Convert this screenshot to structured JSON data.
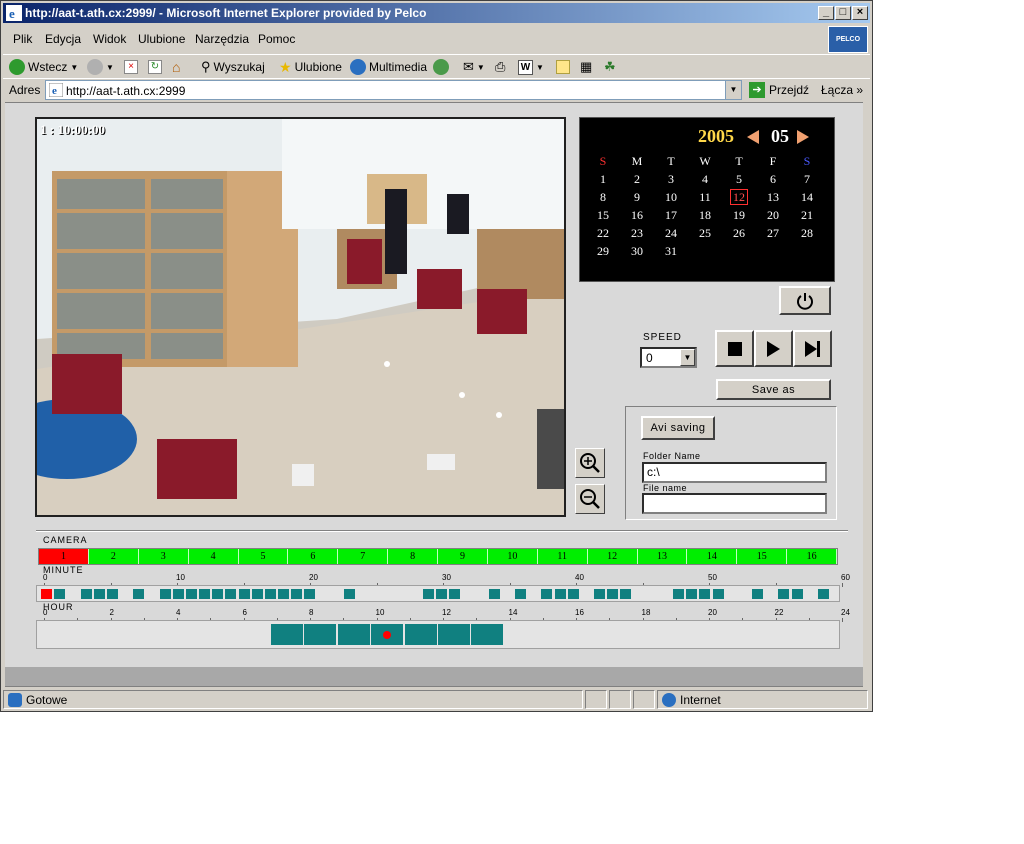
{
  "window": {
    "title": "http://aat-t.ath.cx:2999/ - Microsoft Internet Explorer provided by Pelco",
    "brand": "PELCO"
  },
  "menu": [
    "Plik",
    "Edycja",
    "Widok",
    "Ulubione",
    "Narzędzia",
    "Pomoc"
  ],
  "toolbar": {
    "back": "Wstecz",
    "search": "Wyszukaj",
    "favorites": "Ulubione",
    "media": "Multimedia"
  },
  "address": {
    "label": "Adres",
    "url": "http://aat-t.ath.cx:2999",
    "go": "Przejdź",
    "links": "Łącza"
  },
  "video": {
    "timestamp": "1 : 10:00:00"
  },
  "calendar": {
    "year": "2005",
    "month": "05",
    "weekdays": [
      "S",
      "M",
      "T",
      "W",
      "T",
      "F",
      "S"
    ],
    "weeks": [
      [
        "",
        "1",
        "2",
        "3",
        "4",
        "5",
        "6",
        "7"
      ],
      [
        "8",
        "9",
        "10",
        "11",
        "12",
        "13",
        "14"
      ],
      [
        "15",
        "16",
        "17",
        "18",
        "19",
        "20",
        "21"
      ],
      [
        "22",
        "23",
        "24",
        "25",
        "26",
        "27",
        "28"
      ],
      [
        "29",
        "30",
        "31",
        "",
        "",
        "",
        ""
      ]
    ],
    "selected_day": "12"
  },
  "controls": {
    "speed_label": "SPEED",
    "speed_value": "0",
    "save_as": "Save as",
    "avi_saving": "Avi saving",
    "folder_label": "Folder Name",
    "folder_value": "c:\\",
    "file_label": "File name",
    "file_value": ""
  },
  "timeline": {
    "camera_label": "CAMERA",
    "cameras": [
      "1",
      "2",
      "3",
      "4",
      "5",
      "6",
      "7",
      "8",
      "9",
      "10",
      "11",
      "12",
      "13",
      "14",
      "15",
      "16"
    ],
    "active_camera": "1",
    "minute_label": "MINUTE",
    "minute_ticks": [
      "0",
      "10",
      "20",
      "30",
      "40",
      "50",
      "60"
    ],
    "minute_recorded": [
      0,
      1,
      3,
      4,
      5,
      7,
      9,
      10,
      11,
      12,
      13,
      14,
      15,
      16,
      17,
      18,
      19,
      20,
      23,
      29,
      30,
      31,
      34,
      36,
      38,
      39,
      40,
      42,
      43,
      44,
      48,
      49,
      50,
      51,
      54,
      56,
      57,
      59
    ],
    "minute_current": 0,
    "hour_label": "HOUR",
    "hour_ticks": [
      "0",
      "2",
      "4",
      "6",
      "8",
      "10",
      "12",
      "14",
      "16",
      "18",
      "20",
      "22",
      "24"
    ],
    "hour_recorded": [
      7,
      8,
      9,
      10,
      11,
      12,
      13
    ],
    "hour_current": 10
  },
  "status": {
    "text": "Gotowe",
    "zone": "Internet"
  },
  "colors": {
    "recorded": "#108080",
    "camera_active": "#ff0000",
    "camera_available": "#00ee00"
  }
}
